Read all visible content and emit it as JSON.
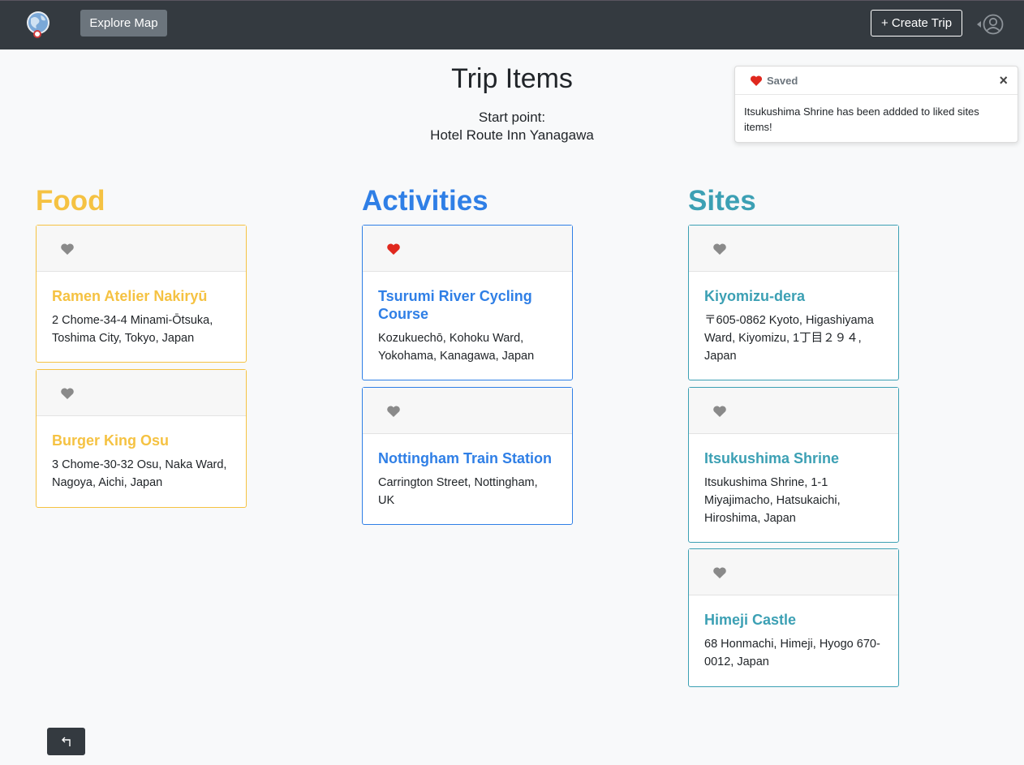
{
  "navbar": {
    "explore_label": "Explore Map",
    "create_label": "+ Create Trip"
  },
  "page": {
    "title": "Trip Items",
    "start_label": "Start point:",
    "start_value": "Hotel Route Inn Yanagawa"
  },
  "toast": {
    "title": "Saved",
    "close": "×",
    "message": "Itsukushima Shrine has been addded to liked sites items!"
  },
  "colors": {
    "food": "#f5c242",
    "activities": "#2f7fe6",
    "sites": "#3ca0b4",
    "heart_liked": "#e0281e",
    "heart_default": "#8a8a8a"
  },
  "sections": {
    "food": {
      "title": "Food",
      "items": [
        {
          "name": "Ramen Atelier Nakiryū",
          "address": "2 Chome-34-4 Minami-Ōtsuka, Toshima City, Tokyo, Japan",
          "liked": false
        },
        {
          "name": "Burger King Osu",
          "address": "3 Chome-30-32 Osu, Naka Ward, Nagoya, Aichi, Japan",
          "liked": false
        }
      ]
    },
    "activities": {
      "title": "Activities",
      "items": [
        {
          "name": "Tsurumi River Cycling Course",
          "address": "Kozukuechō, Kohoku Ward, Yokohama, Kanagawa, Japan",
          "liked": true
        },
        {
          "name": "Nottingham Train Station",
          "address": "Carrington Street, Nottingham, UK",
          "liked": false
        }
      ]
    },
    "sites": {
      "title": "Sites",
      "items": [
        {
          "name": "Kiyomizu-dera",
          "address": "〒605-0862 Kyoto, Higashiyama Ward, Kiyomizu, 1丁目２９４, Japan",
          "liked": false
        },
        {
          "name": "Itsukushima Shrine",
          "address": "Itsukushima Shrine, 1-1 Miyajimacho, Hatsukaichi, Hiroshima, Japan",
          "liked": false
        },
        {
          "name": "Himeji Castle",
          "address": "68 Honmachi, Himeji, Hyogo 670-0012, Japan",
          "liked": false
        }
      ]
    }
  },
  "icons": {
    "logo": "globe-logo-icon",
    "user": "user-circle-icon",
    "heart": "heart-icon",
    "back": "back-arrow-icon"
  }
}
